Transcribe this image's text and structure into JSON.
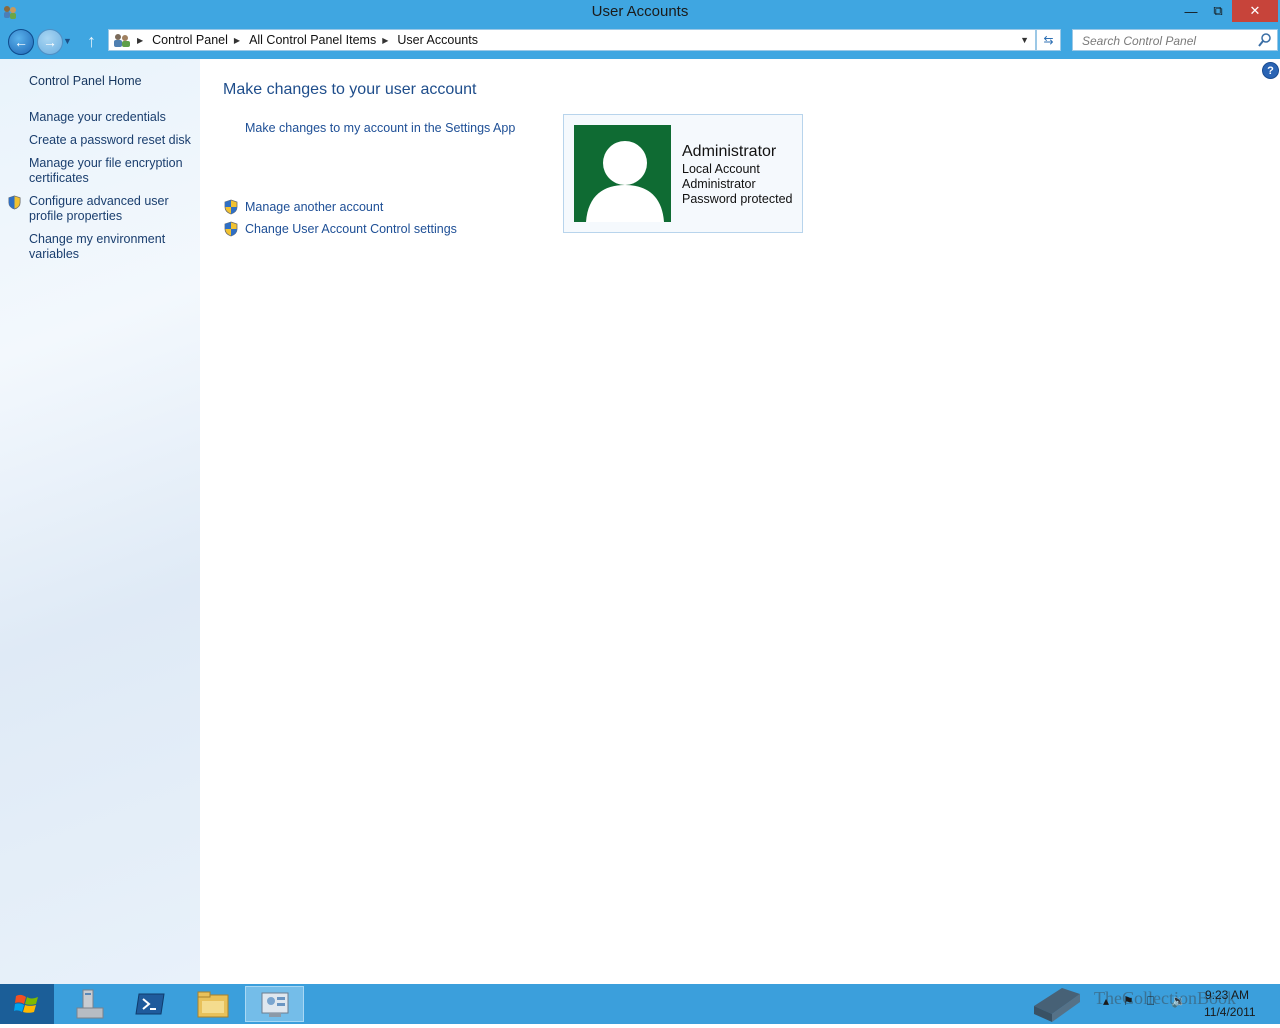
{
  "window": {
    "title": "User Accounts",
    "minimize_glyph": "—",
    "maximize_glyph": "⧉",
    "close_glyph": "✕"
  },
  "nav": {
    "breadcrumbs": [
      "Control Panel",
      "All Control Panel Items",
      "User Accounts"
    ],
    "search_placeholder": "Search Control Panel"
  },
  "sidebar": {
    "home": "Control Panel Home",
    "items": [
      {
        "label": "Manage your credentials",
        "shield": false
      },
      {
        "label": "Create a password reset disk",
        "shield": false
      },
      {
        "label": "Manage your file encryption certificates",
        "shield": false
      },
      {
        "label": "Configure advanced user profile properties",
        "shield": true
      },
      {
        "label": "Change my environment variables",
        "shield": false
      }
    ]
  },
  "main": {
    "heading": "Make changes to your user account",
    "settings_link": "Make changes to my account in the Settings App",
    "admin_links": [
      "Manage another account",
      "Change User Account Control settings"
    ]
  },
  "account": {
    "name": "Administrator",
    "type": "Local Account",
    "group": "Administrator",
    "status": "Password protected",
    "avatar_color": "#0f6b33"
  },
  "taskbar": {
    "items": [
      "server-manager-icon",
      "powershell-icon",
      "file-explorer-icon",
      "control-panel-icon"
    ],
    "active_item": "control-panel-icon",
    "clock_time": "9:23 AM",
    "clock_date": "11/4/2011",
    "watermark": "TheCollectionBook"
  },
  "colors": {
    "titlebar": "#3fa6e1",
    "taskbar": "#3b9fdc",
    "link": "#1e4f96",
    "close_button": "#c7443a"
  }
}
